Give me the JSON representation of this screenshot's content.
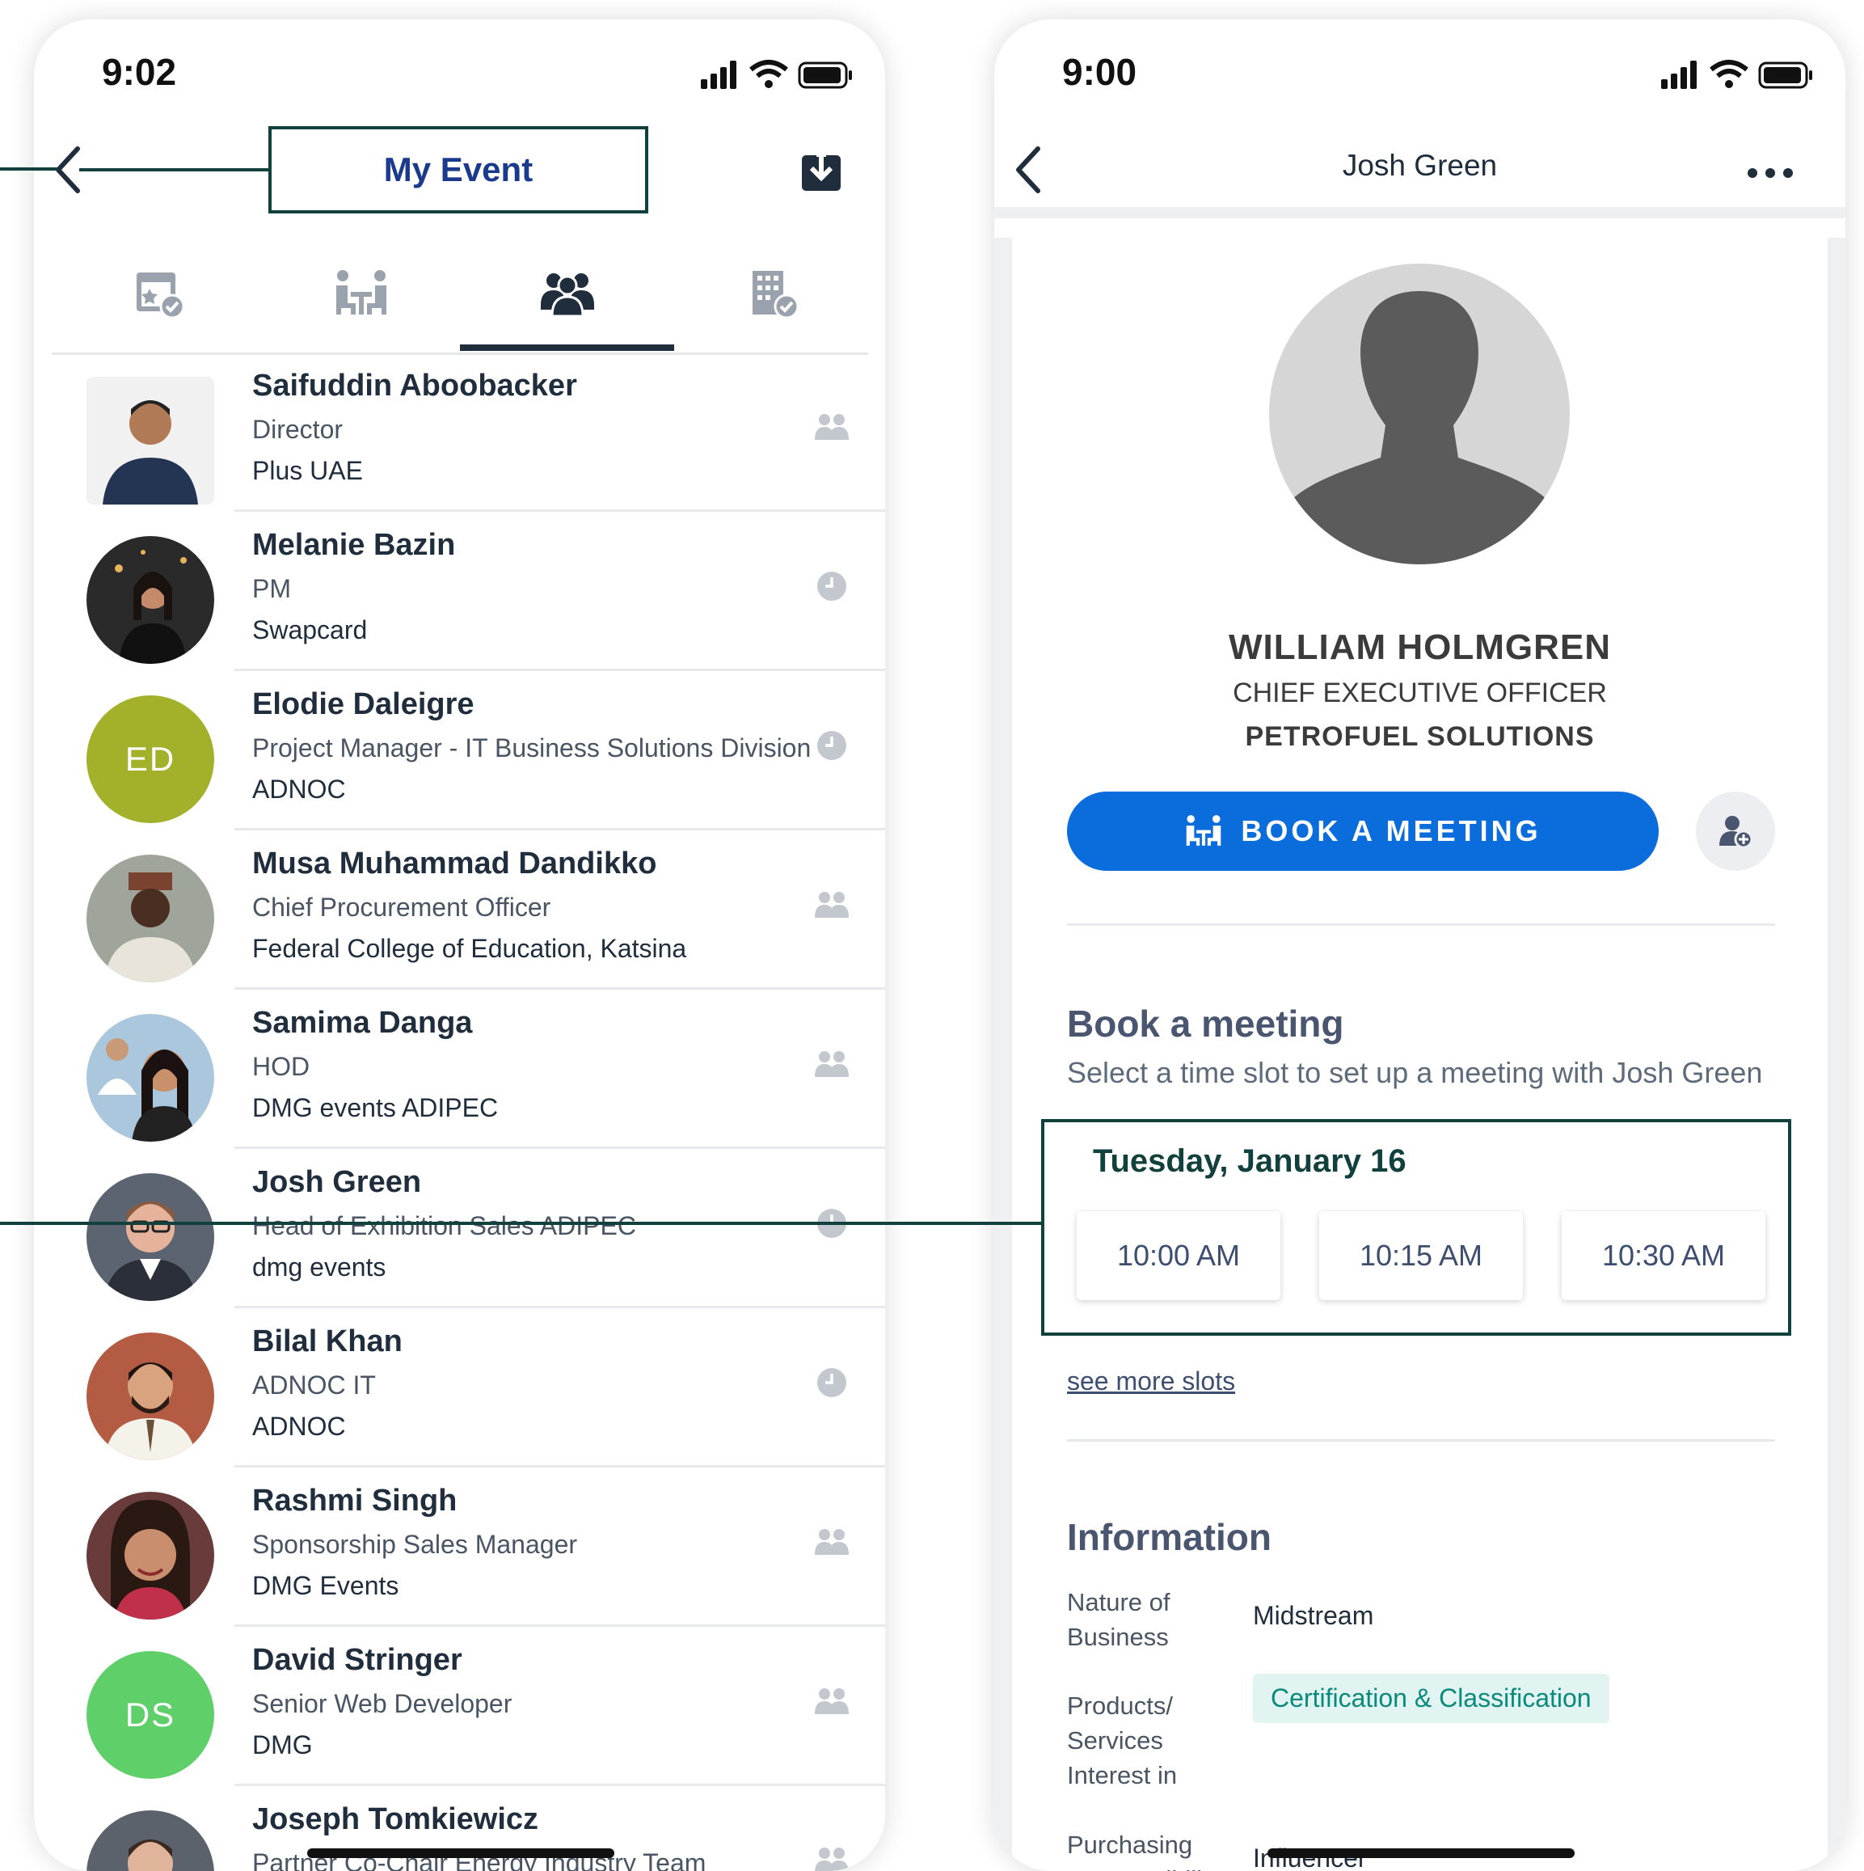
{
  "left_phone": {
    "status_time": "9:02",
    "title": "My Event",
    "tabs": [
      {
        "icon": "calendar-star-icon"
      },
      {
        "icon": "meeting-icon"
      },
      {
        "icon": "people-icon",
        "active": true
      },
      {
        "icon": "building-check-icon"
      }
    ],
    "people": [
      {
        "name": "Saifuddin Aboobacker",
        "role": "Director",
        "company": "Plus UAE",
        "avatar": "photo",
        "status_icon": "people-icon"
      },
      {
        "name": "Melanie Bazin",
        "role": "PM",
        "company": "Swapcard",
        "avatar": "photo",
        "status_icon": "clock-icon"
      },
      {
        "name": "Elodie Daleigre",
        "role": "Project Manager - IT Business Solutions Division",
        "company": "ADNOC",
        "avatar": "ED",
        "avatar_color": "#a3b12a",
        "status_icon": "clock-icon"
      },
      {
        "name": "Musa Muhammad Dandikko",
        "role": "Chief Procurement Officer",
        "company": "Federal College of Education, Katsina",
        "avatar": "photo",
        "status_icon": "people-icon"
      },
      {
        "name": "Samima Danga",
        "role": "HOD",
        "company": "DMG events ADIPEC",
        "avatar": "photo",
        "status_icon": "people-icon"
      },
      {
        "name": "Josh Green",
        "role": "Head of Exhibition Sales ADIPEC",
        "company": "dmg events",
        "avatar": "photo",
        "status_icon": "clock-icon"
      },
      {
        "name": "Bilal Khan",
        "role": "ADNOC IT",
        "company": "ADNOC",
        "avatar": "photo",
        "status_icon": "clock-icon"
      },
      {
        "name": "Rashmi Singh",
        "role": "Sponsorship Sales Manager",
        "company": "DMG Events",
        "avatar": "photo",
        "status_icon": "people-icon"
      },
      {
        "name": "David Stringer",
        "role": "Senior Web Developer",
        "company": "DMG",
        "avatar": "DS",
        "avatar_color": "#5fcf6a",
        "status_icon": "people-icon"
      },
      {
        "name": "Joseph Tomkiewicz",
        "role": "Partner Co-Chair Energy Industry Team",
        "company": "",
        "avatar": "photo",
        "status_icon": "people-icon"
      }
    ]
  },
  "right_phone": {
    "status_time": "9:00",
    "header_title": "Josh Green",
    "profile": {
      "name": "WILLIAM HOLMGREN",
      "job_title": "CHIEF EXECUTIVE OFFICER",
      "company": "PETROFUEL SOLUTIONS"
    },
    "book_button": "BOOK A MEETING",
    "book_section": {
      "title": "Book a meeting",
      "subtitle": "Select a time slot to set up a meeting with Josh Green",
      "date": "Tuesday, January 16",
      "slots": [
        "10:00 AM",
        "10:15 AM",
        "10:30 AM"
      ],
      "more_link": "see more slots"
    },
    "information": {
      "title": "Information",
      "fields": [
        {
          "label": "Nature of Business",
          "value": "Midstream"
        },
        {
          "label": "Products/ Services Interest in",
          "value": "Certification & Classification"
        },
        {
          "label": "Purchasing Responsibility",
          "value": "Influencer"
        }
      ]
    }
  },
  "colors": {
    "accent_blue": "#0a6ddb",
    "title_blue": "#1b3a8c",
    "highlight_border": "#12403c",
    "tag_bg": "#e2f4f2",
    "tag_text": "#0a8a7a"
  }
}
